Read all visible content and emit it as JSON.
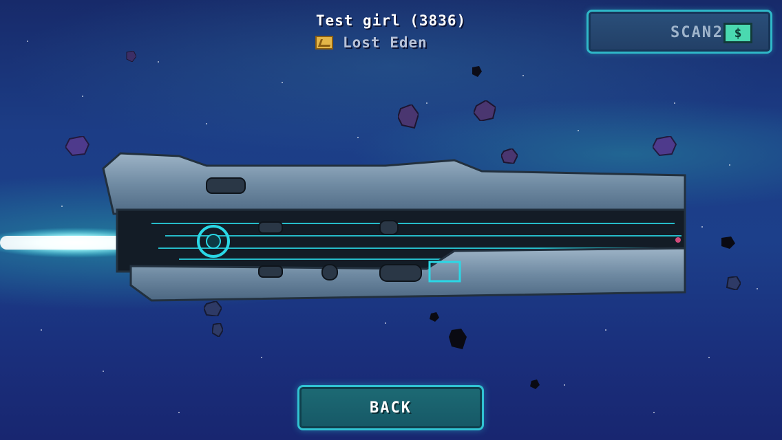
{
  "player": {
    "name": "Test girl (3836)"
  },
  "alliance": {
    "name": "Lost Eden",
    "badge_icon": "gold-chevron-badge"
  },
  "scan": {
    "label": "SCAN",
    "count": "2",
    "cost_symbol": "$"
  },
  "actions": {
    "back_label": "BACK"
  },
  "colors": {
    "accent": "#31c3d2",
    "scan_cost": "#4ad9b0",
    "badge": "#e4b648"
  }
}
